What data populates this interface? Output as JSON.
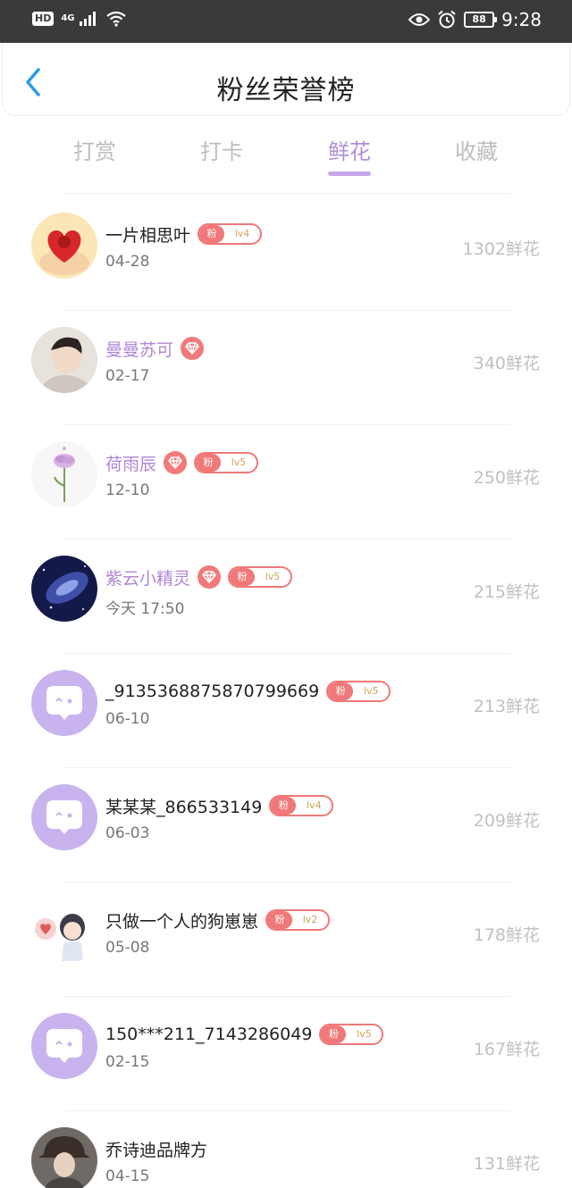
{
  "status_bar": {
    "hd": "HD",
    "network": "4G",
    "battery": "88",
    "time": "9:28"
  },
  "header": {
    "title": "粉丝荣誉榜"
  },
  "tabs": [
    {
      "label": "打赏",
      "active": false
    },
    {
      "label": "打卡",
      "active": false
    },
    {
      "label": "鲜花",
      "active": true
    },
    {
      "label": "收藏",
      "active": false
    }
  ],
  "colors": {
    "accent": "#b08fd8",
    "badge_red": "#f07878",
    "vip_name": "#b085d8"
  },
  "fan_label": "粉",
  "entries": [
    {
      "name": "一片相思叶",
      "vip": false,
      "level": "lv4",
      "date": "04-28",
      "score": "1302鲜花",
      "avatar": "heart-rose-avatar"
    },
    {
      "name": "曼曼苏可",
      "vip": true,
      "level": "",
      "date": "02-17",
      "score": "340鲜花",
      "avatar": "user-photo-avatar"
    },
    {
      "name": "荷雨辰",
      "vip": true,
      "level": "lv5",
      "date": "12-10",
      "score": "250鲜花",
      "avatar": "flower-avatar"
    },
    {
      "name": "紫云小精灵",
      "vip": true,
      "level": "lv5",
      "date": "今天 17:50",
      "score": "215鲜花",
      "avatar": "galaxy-avatar"
    },
    {
      "name": "_9135368875870799669",
      "vip": false,
      "level": "lv5",
      "date": "06-10",
      "score": "213鲜花",
      "avatar": "default-chat-avatar"
    },
    {
      "name": "某某某_866533149",
      "vip": false,
      "level": "lv4",
      "date": "06-03",
      "score": "209鲜花",
      "avatar": "default-chat-avatar"
    },
    {
      "name": "只做一个人的狗崽崽",
      "vip": false,
      "level": "lv2",
      "date": "05-08",
      "score": "178鲜花",
      "avatar": "cartoon-avatar"
    },
    {
      "name": "150***211_7143286049",
      "vip": false,
      "level": "lv5",
      "date": "02-15",
      "score": "167鲜花",
      "avatar": "default-chat-avatar"
    },
    {
      "name": "乔诗迪品牌方",
      "vip": false,
      "level": "",
      "date": "04-15",
      "score": "131鲜花",
      "avatar": "user-photo-avatar"
    }
  ]
}
